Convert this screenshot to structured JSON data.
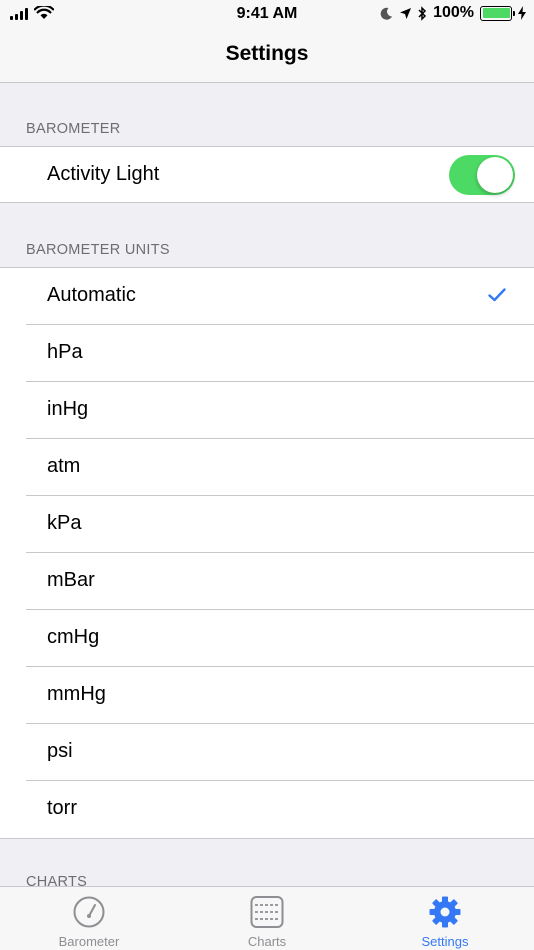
{
  "status_bar": {
    "time": "9:41 AM",
    "battery": "100%"
  },
  "nav": {
    "title": "Settings"
  },
  "sections": {
    "barometer": {
      "header": "BAROMETER",
      "activity_light_label": "Activity Light",
      "activity_light_on": true
    },
    "units": {
      "header": "BAROMETER UNITS",
      "options": [
        "Automatic",
        "hPa",
        "inHg",
        "atm",
        "kPa",
        "mBar",
        "cmHg",
        "mmHg",
        "psi",
        "torr"
      ],
      "selected": "Automatic"
    },
    "charts": {
      "header": "CHARTS"
    }
  },
  "tab_bar": {
    "tabs": [
      {
        "label": "Barometer",
        "icon": "gauge-icon",
        "active": false
      },
      {
        "label": "Charts",
        "icon": "chart-icon",
        "active": false
      },
      {
        "label": "Settings",
        "icon": "gear-icon",
        "active": true
      }
    ]
  },
  "colors": {
    "accent": "#3478f6",
    "toggle_on": "#4cd964",
    "background": "#efeff4",
    "separator": "#c8c7cc"
  }
}
